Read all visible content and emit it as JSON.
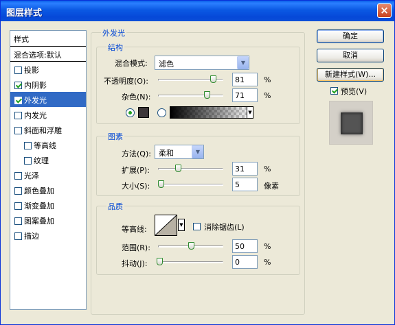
{
  "window": {
    "title": "图层样式",
    "close_glyph": "×"
  },
  "styles_list": {
    "header": "样式",
    "blend_options": "混合选项:默认",
    "items": [
      {
        "label": "投影",
        "checked": false
      },
      {
        "label": "内阴影",
        "checked": true
      },
      {
        "label": "外发光",
        "checked": true,
        "selected": true
      },
      {
        "label": "内发光",
        "checked": false
      },
      {
        "label": "斜面和浮雕",
        "checked": false
      },
      {
        "label": "等高线",
        "checked": false,
        "sub": true
      },
      {
        "label": "纹理",
        "checked": false,
        "sub": true
      },
      {
        "label": "光泽",
        "checked": false
      },
      {
        "label": "颜色叠加",
        "checked": false
      },
      {
        "label": "渐变叠加",
        "checked": false
      },
      {
        "label": "图案叠加",
        "checked": false
      },
      {
        "label": "描边",
        "checked": false
      }
    ]
  },
  "outer_glow": {
    "title": "外发光",
    "structure": {
      "title": "结构",
      "blend_mode_label": "混合模式:",
      "blend_mode_value": "滤色",
      "opacity_label": "不透明度(O):",
      "opacity_value": "81",
      "noise_label": "杂色(N):",
      "noise_value": "71",
      "percent": "%",
      "color": "#3d3739"
    },
    "elements": {
      "title": "图素",
      "technique_label": "方法(Q):",
      "technique_value": "柔和",
      "spread_label": "扩展(P):",
      "spread_value": "31",
      "size_label": "大小(S):",
      "size_value": "5",
      "size_unit": "像素",
      "percent": "%"
    },
    "quality": {
      "title": "品质",
      "contour_label": "等高线:",
      "antialias_label": "消除锯齿(L)",
      "antialias_checked": false,
      "range_label": "范围(R):",
      "range_value": "50",
      "jitter_label": "抖动(J):",
      "jitter_value": "0",
      "percent": "%"
    }
  },
  "buttons": {
    "ok": "确定",
    "cancel": "取消",
    "new_style": "新建样式(W)...",
    "preview_label": "预览(V)",
    "preview_checked": true
  }
}
